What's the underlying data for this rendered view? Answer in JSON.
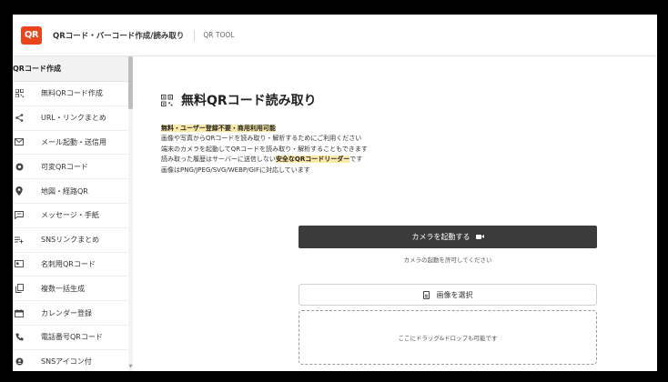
{
  "header": {
    "logo": "QR",
    "app_title": "QRコード・バーコード作成/読み取り",
    "tool_label": "QR TOOL"
  },
  "sidebar": {
    "section_title": "QRコード作成",
    "items": [
      {
        "label": "無料QRコード作成",
        "icon": "qr-grid-icon"
      },
      {
        "label": "URL・リンクまとめ",
        "icon": "share-icon"
      },
      {
        "label": "メール起動・送信用",
        "icon": "mail-icon"
      },
      {
        "label": "可変QRコード",
        "icon": "dynamic-icon"
      },
      {
        "label": "地図・経路QR",
        "icon": "map-pin-icon"
      },
      {
        "label": "メッセージ・手紙",
        "icon": "message-icon"
      },
      {
        "label": "SNSリンクまとめ",
        "icon": "sns-list-icon"
      },
      {
        "label": "名刺用QRコード",
        "icon": "card-icon"
      },
      {
        "label": "複数一括生成",
        "icon": "copy-icon"
      },
      {
        "label": "カレンダー登録",
        "icon": "calendar-icon"
      },
      {
        "label": "電話番号QRコード",
        "icon": "phone-icon"
      },
      {
        "label": "SNSアイコン付",
        "icon": "sns-icon"
      }
    ]
  },
  "main": {
    "title": "無料QRコード読み取り",
    "desc_highlight_1": "無料・ユーザー登録不要・商用利用可能",
    "desc_line_2": "画像や写真からQRコードを読み取り・解析するためにご利用ください",
    "desc_line_3": "端末のカメラを起動してQRコードを読み取り・解析することもできます",
    "desc_line_4_pre": "読み取った履歴はサーバーに送信しない",
    "desc_line_4_hl": "安全なQRコードリーダー",
    "desc_line_4_post": "です",
    "desc_line_5": "画像はPNG/JPEG/SVG/WEBP/GIFに対応しています",
    "camera_button": "カメラを起動する",
    "camera_note": "カメラの起動を許可してください",
    "select_button": "画像を選択",
    "drop_zone": "ここにドラッグ&ドロップも可能です"
  }
}
